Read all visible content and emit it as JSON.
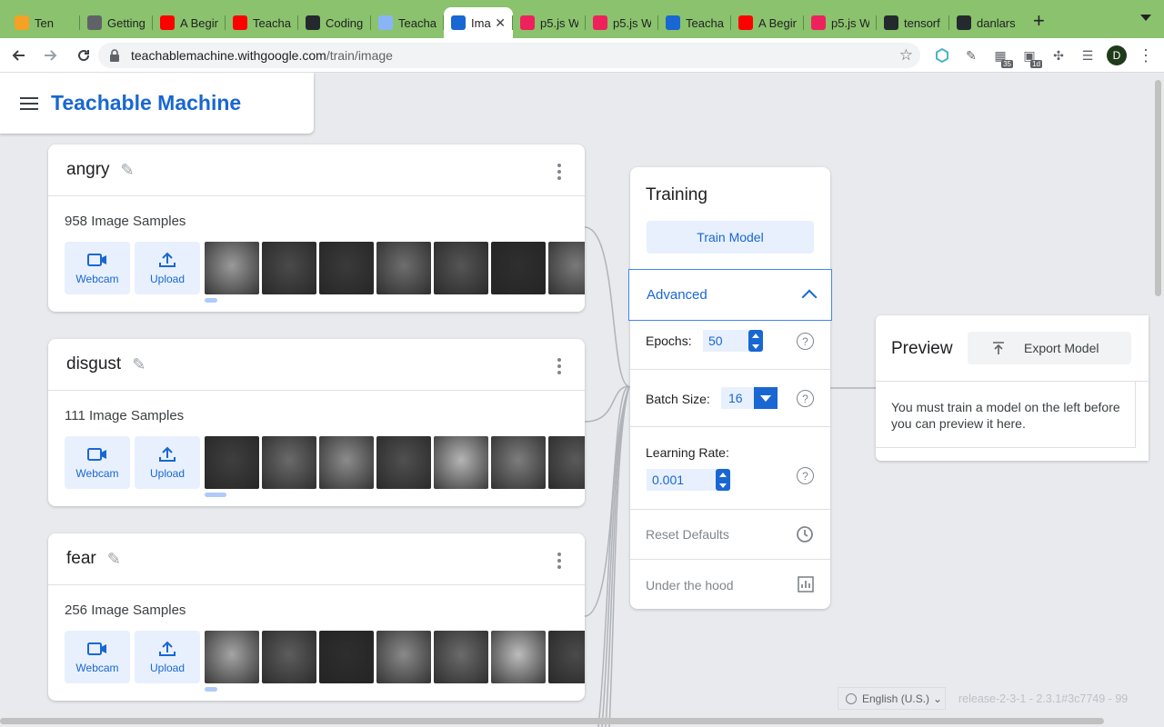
{
  "browser": {
    "tabs": [
      {
        "title": "Ten",
        "favicon": "orange-tm-icon",
        "color": "#f4a125"
      },
      {
        "title": "Getting",
        "favicon": "globe-icon",
        "color": "#5f6368"
      },
      {
        "title": "A Begin",
        "favicon": "youtube-icon",
        "color": "#ff0000"
      },
      {
        "title": "Teacha",
        "favicon": "youtube-icon",
        "color": "#ff0000"
      },
      {
        "title": "Coding",
        "favicon": "github-icon",
        "color": "#24292e"
      },
      {
        "title": "Teacha",
        "favicon": "page-icon",
        "color": "#8ab4f8"
      },
      {
        "title": "Imag",
        "favicon": "tm-icon",
        "color": "#1967d2"
      },
      {
        "title": "p5.js W",
        "favicon": "p5-icon",
        "color": "#ed225d"
      },
      {
        "title": "p5.js W",
        "favicon": "p5-icon",
        "color": "#ed225d"
      },
      {
        "title": "Teacha",
        "favicon": "tm-icon",
        "color": "#1967d2"
      },
      {
        "title": "A Begin",
        "favicon": "youtube-icon",
        "color": "#ff0000"
      },
      {
        "title": "p5.js W",
        "favicon": "p5-icon",
        "color": "#ed225d"
      },
      {
        "title": "tensorf",
        "favicon": "github-icon",
        "color": "#24292e"
      },
      {
        "title": "danlars",
        "favicon": "github-icon",
        "color": "#24292e"
      }
    ],
    "active_tab_index": 6,
    "new_tab": "+",
    "url_host": "teachablemachine.withgoogle.com",
    "url_path": "/train/image",
    "ext_badges": [
      "35",
      "1d"
    ],
    "profile_initial": "D"
  },
  "app": {
    "title": "Teachable Machine"
  },
  "classes": [
    {
      "name": "angry",
      "samples": "958 Image Samples",
      "webcam": "Webcam",
      "upload": "Upload",
      "thumbs": [
        "#9a9a9a",
        "#4a4a4a",
        "#3a3a3a",
        "#6e6e6e",
        "#555555",
        "#2f2f2f",
        "#7a7a7a"
      ]
    },
    {
      "name": "disgust",
      "samples": "111 Image Samples",
      "webcam": "Webcam",
      "upload": "Upload",
      "thumbs": [
        "#3f3f3f",
        "#6a6a6a",
        "#8c8c8c",
        "#505050",
        "#b5b5b5",
        "#7d7d7d",
        "#5a5a5a"
      ]
    },
    {
      "name": "fear",
      "samples": "256 Image Samples",
      "webcam": "Webcam",
      "upload": "Upload",
      "thumbs": [
        "#a5a5a5",
        "#5d5d5d",
        "#2e2e2e",
        "#8a8a8a",
        "#6b6b6b",
        "#bdbdbd",
        "#4b4b4b"
      ]
    }
  ],
  "training": {
    "title": "Training",
    "train_button": "Train Model",
    "advanced": "Advanced",
    "epochs_label": "Epochs:",
    "epochs_value": "50",
    "batch_label": "Batch Size:",
    "batch_value": "16",
    "lr_label": "Learning Rate:",
    "lr_value": "0.001",
    "reset": "Reset Defaults",
    "hood": "Under the hood",
    "help": "?"
  },
  "preview": {
    "title": "Preview",
    "export_button": "Export Model",
    "message": "You must train a model on the left before you can preview it here."
  },
  "footer": {
    "language": "English (U.S.)",
    "release": "release-2-3-1 - 2.3.1#3c7749 - 99"
  },
  "colors": {
    "accent": "#1967d2",
    "accent_light": "#e8f0fe",
    "tabbar": "#8bc26d"
  }
}
